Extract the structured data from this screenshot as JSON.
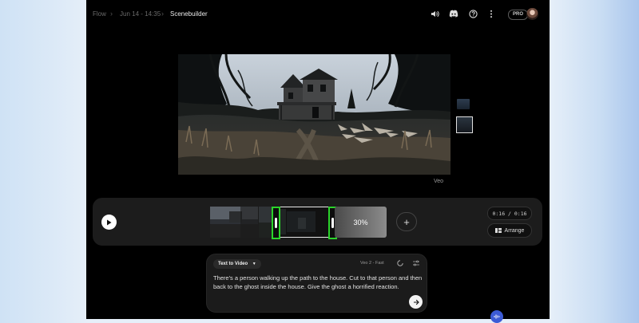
{
  "breadcrumb": {
    "app": "Flow",
    "project": "Jun 14 - 14:35",
    "current": "Scenebuilder",
    "separator": "›"
  },
  "topbar": {
    "icons": [
      "volume-icon",
      "discord-icon",
      "help-icon",
      "more-vert-icon"
    ],
    "badge": "PRO"
  },
  "preview": {
    "model_label": "Veo"
  },
  "timeline": {
    "trim_percent": "30%",
    "add_label": "+",
    "time": "0:16 / 0:16",
    "arrange_label": "Arrange"
  },
  "prompt": {
    "mode": "Text to Video",
    "model": "Veo 2 - Fast",
    "text": "There's a person walking up the path to the house. Cut to that person and then back to the ghost inside the house. Give the ghost a horrified reaction."
  },
  "colors": {
    "trim_handle": "#2bd42b",
    "assistant_button": "#3c5bd6"
  }
}
